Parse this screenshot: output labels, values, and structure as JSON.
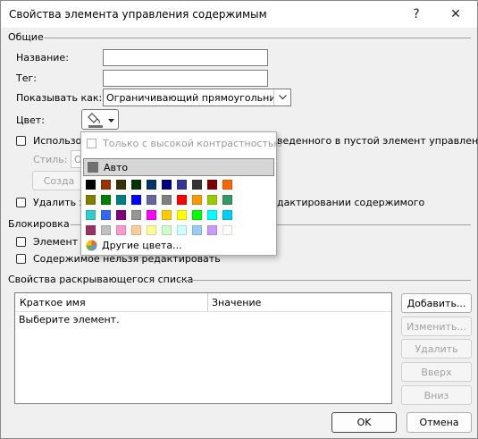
{
  "window": {
    "title": "Свойства элемента управления содержимым",
    "help_glyph": "?",
    "close_glyph": "✕"
  },
  "general": {
    "section_title": "Общие",
    "name_label": "Название:",
    "name_value": "",
    "tag_label": "Тег:",
    "tag_value": "",
    "show_as_label": "Показывать как:",
    "show_as_value": "Ограничивающий прямоугольник",
    "color_label": "Цвет:",
    "use_style_label": "Использов",
    "use_style_suffix": "веденного в пустой элемент управления",
    "style_label": "Стиль:",
    "style_value": "О",
    "create_style_label": "Созда",
    "remove_label": "Удалить эл",
    "remove_suffix": "дактировании содержимого"
  },
  "locking": {
    "section_title": "Блокировка",
    "cannot_delete_label": "Элемент у",
    "cannot_edit_label": "Содержимое нельзя редактировать"
  },
  "dropdown_props": {
    "section_title": "Свойства раскрывающегося списка",
    "col_display": "Краткое имя",
    "col_value": "Значение",
    "placeholder": "Выберите элемент.",
    "add": "Добавить...",
    "modify": "Изменить...",
    "remove": "Удалить",
    "up": "Вверх",
    "down": "Вниз"
  },
  "footer": {
    "ok": "OK",
    "cancel": "Отмена"
  },
  "color_popup": {
    "high_contrast_label": "Только с высокой контрастностью",
    "auto_label": "Авто",
    "auto_color": "#707070",
    "more_colors_label": "Другие цвета...",
    "rows": [
      [
        "#000000",
        "#993300",
        "#333300",
        "#003300",
        "#003366",
        "#000080",
        "#333399",
        "#333333",
        "#800000",
        "#FF6600"
      ],
      [
        "#808000",
        "#008000",
        "#008080",
        "#0000FF",
        "#666699",
        "#808080",
        "#FF0000",
        "#FF9900",
        "#99CC00",
        "#339966"
      ],
      [
        "#33CCCC",
        "#3366FF",
        "#800080",
        "#969696",
        "#FF00FF",
        "#FFCC00",
        "#FFFF00",
        "#00FF00",
        "#00FFFF",
        "#00CCFF"
      ],
      [
        "#993366",
        "#C0C0C0",
        "#FF99CC",
        "#FFCC99",
        "#FFFF99",
        "#CCFFCC",
        "#CCFFFF",
        "#99CCFF",
        "#CC99FF",
        "#FFFFFF"
      ]
    ]
  }
}
